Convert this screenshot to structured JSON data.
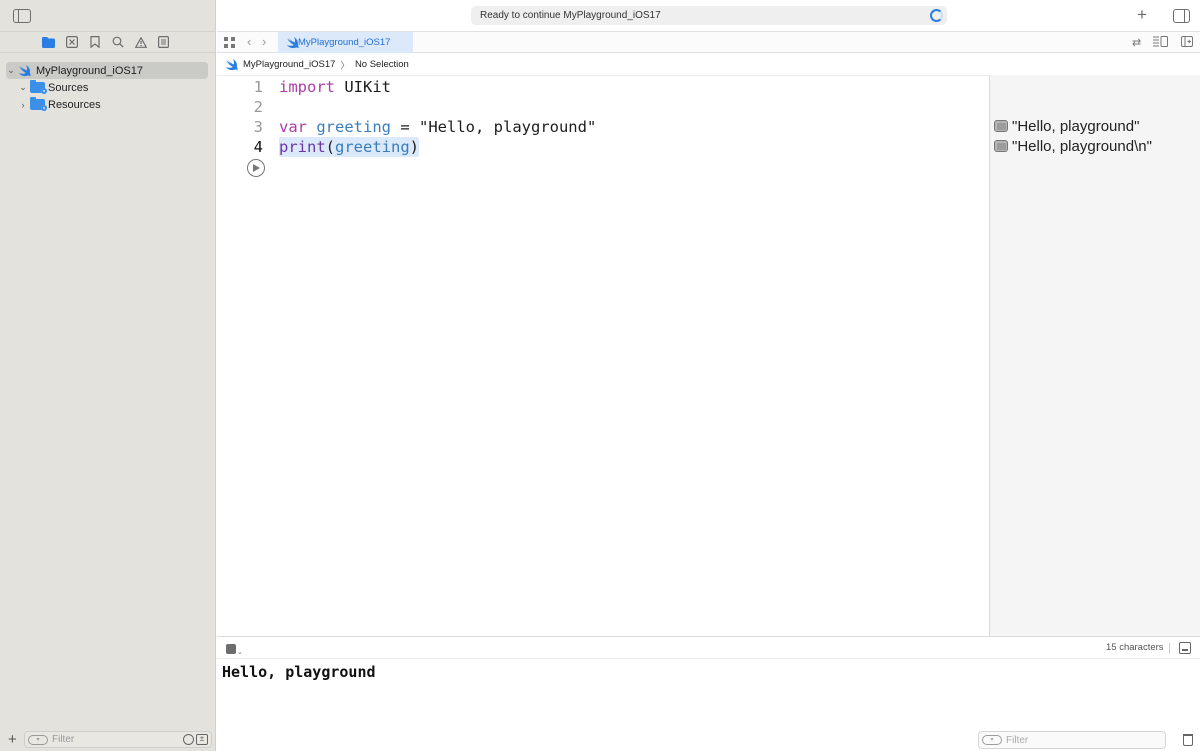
{
  "toolbar": {
    "status_text": "Ready to continue MyPlayground_iOS17",
    "add_label": "+"
  },
  "tabbar": {
    "active_tab": "MyPlayground_iOS17",
    "back_glyph": "‹",
    "forward_glyph": "›"
  },
  "breadcrumb": {
    "project": "MyPlayground_iOS17",
    "separator": "〉",
    "selection": "No Selection"
  },
  "navigator": {
    "root": "MyPlayground_iOS17",
    "items": [
      {
        "label": "Sources",
        "chevron": "⌄"
      },
      {
        "label": "Resources",
        "chevron": "›"
      }
    ],
    "root_chevron": "⌄"
  },
  "editor": {
    "lines": [
      {
        "number": "1",
        "kw": "import",
        "rest": " UIKit"
      },
      {
        "number": "2"
      },
      {
        "number": "3",
        "kw": "var",
        "ident": "greeting",
        "op": " = ",
        "str": "\"Hello, playground\""
      },
      {
        "number": "4",
        "fn": "print",
        "open": "(",
        "arg": "greeting",
        "close": ")"
      }
    ],
    "current_line": "4"
  },
  "results": [
    "\"Hello, playground\"",
    "\"Hello, playground\\n\""
  ],
  "debug": {
    "char_count": "15 characters"
  },
  "console": {
    "output": "Hello, playground",
    "filter_placeholder": "Filter"
  },
  "sidebar_filter": {
    "placeholder": "Filter"
  },
  "colors": {
    "accent": "#1f6fd1",
    "keyword": "#ad3da4",
    "identifier": "#3a7dbb",
    "sidebar_bg": "#e3e2dd",
    "tab_bg": "#dce9fb"
  }
}
